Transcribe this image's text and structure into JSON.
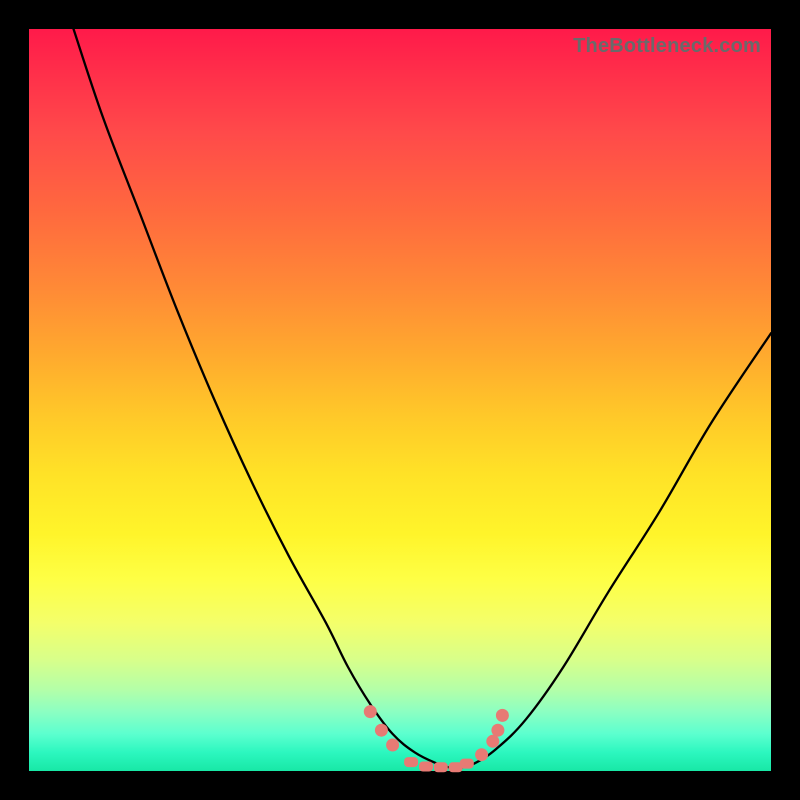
{
  "watermark": "TheBottleneck.com",
  "colors": {
    "frame": "#000000",
    "curve": "#000000",
    "marker": "#e77a74"
  },
  "chart_data": {
    "type": "line",
    "title": "",
    "xlabel": "",
    "ylabel": "",
    "xlim": [
      0,
      100
    ],
    "ylim": [
      0,
      100
    ],
    "grid": false,
    "legend": false,
    "series": [
      {
        "name": "bottleneck-curve",
        "x": [
          6,
          10,
          15,
          20,
          25,
          30,
          35,
          40,
          43,
          46,
          49,
          52,
          55,
          57,
          58,
          60,
          63,
          67,
          72,
          78,
          85,
          92,
          100
        ],
        "y": [
          100,
          88,
          75,
          62,
          50,
          39,
          29,
          20,
          14,
          9,
          5,
          2.5,
          1,
          0.4,
          0.4,
          1,
          3,
          7,
          14,
          24,
          35,
          47,
          59
        ]
      }
    ],
    "markers": [
      {
        "x": 46.0,
        "y": 8.0
      },
      {
        "x": 47.5,
        "y": 5.5
      },
      {
        "x": 49.0,
        "y": 3.5
      },
      {
        "x": 51.5,
        "y": 1.2
      },
      {
        "x": 53.5,
        "y": 0.6
      },
      {
        "x": 55.5,
        "y": 0.5
      },
      {
        "x": 57.5,
        "y": 0.5
      },
      {
        "x": 59.0,
        "y": 1.0
      },
      {
        "x": 61.0,
        "y": 2.2
      },
      {
        "x": 62.5,
        "y": 4.0
      },
      {
        "x": 63.2,
        "y": 5.5
      },
      {
        "x": 63.8,
        "y": 7.5
      }
    ],
    "background_gradient": {
      "orientation": "vertical",
      "stops": [
        {
          "pos": 0.0,
          "color": "#ff1a4a"
        },
        {
          "pos": 0.25,
          "color": "#ff6a3e"
        },
        {
          "pos": 0.5,
          "color": "#ffc829"
        },
        {
          "pos": 0.75,
          "color": "#feff44"
        },
        {
          "pos": 1.0,
          "color": "#18e8a6"
        }
      ]
    }
  }
}
